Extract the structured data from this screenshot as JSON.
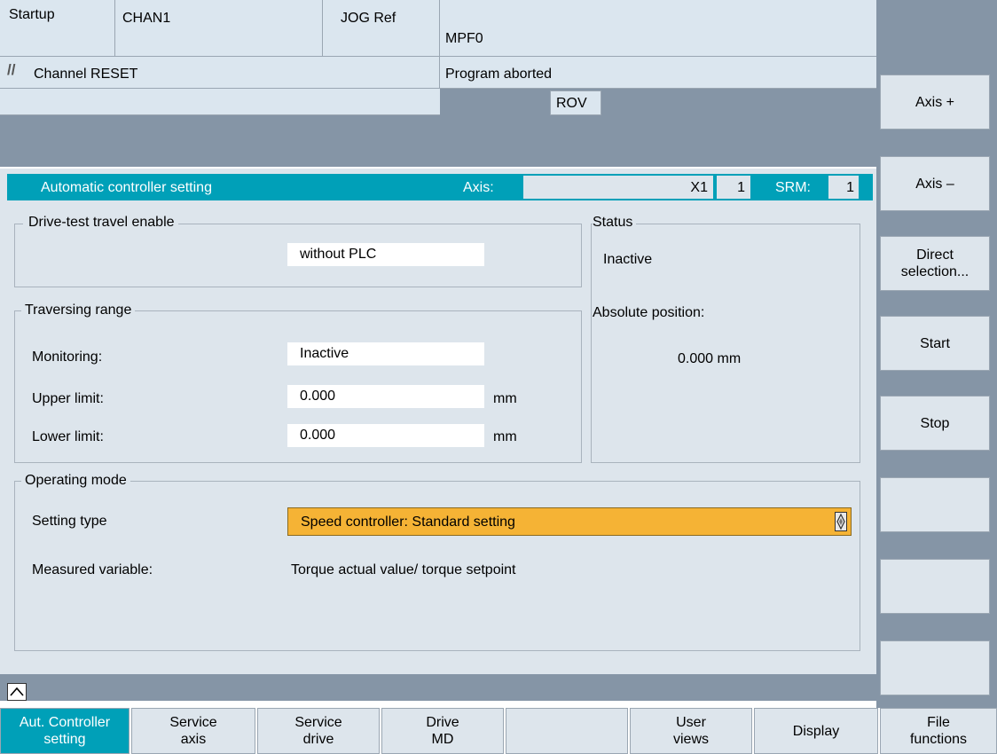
{
  "header": {
    "area": "Startup",
    "channel": "CHAN1",
    "mode": "JOG Ref",
    "program": "MPF0",
    "channel_status": "Channel RESET",
    "program_status": "Program aborted",
    "override": "ROV"
  },
  "title_bar": {
    "title": "Automatic controller setting",
    "axis_label": "Axis:",
    "axis_name": "X1",
    "axis_number": "1",
    "srm_label": "SRM:",
    "srm_value": "1"
  },
  "drive_test": {
    "title": "Drive-test travel enable",
    "value": "without PLC"
  },
  "status": {
    "title": "Status",
    "value": "Inactive",
    "abs_label": "Absolute position:",
    "abs_value": "0.000 mm"
  },
  "traversing": {
    "title": "Traversing range",
    "monitoring_label": "Monitoring:",
    "monitoring_value": "Inactive",
    "upper_label": "Upper limit:",
    "upper_value": "0.000",
    "upper_unit": "mm",
    "lower_label": "Lower limit:",
    "lower_value": "0.000",
    "lower_unit": "mm"
  },
  "operating_mode": {
    "title": "Operating mode",
    "setting_label": "Setting type",
    "setting_value": "Speed controller: Standard setting",
    "measured_label": "Measured variable:",
    "measured_value": "Torque actual value/ torque setpoint"
  },
  "right_softkeys": [
    {
      "line1": "Axis +",
      "line2": ""
    },
    {
      "line1": "Axis –",
      "line2": ""
    },
    {
      "line1": "Direct",
      "line2": "selection..."
    },
    {
      "line1": "Start",
      "line2": ""
    },
    {
      "line1": "Stop",
      "line2": ""
    },
    {
      "line1": "",
      "line2": ""
    },
    {
      "line1": "",
      "line2": ""
    },
    {
      "line1": "",
      "line2": ""
    }
  ],
  "bottom_softkeys": [
    {
      "line1": "Aut. Controller",
      "line2": "setting"
    },
    {
      "line1": "Service",
      "line2": "axis"
    },
    {
      "line1": "Service",
      "line2": "drive"
    },
    {
      "line1": "Drive",
      "line2": "MD"
    },
    {
      "line1": "",
      "line2": ""
    },
    {
      "line1": "User",
      "line2": "views"
    },
    {
      "line1": "Display",
      "line2": ""
    },
    {
      "line1": "File",
      "line2": "functions"
    }
  ],
  "colors": {
    "accent": "#00a0b8",
    "highlight": "#f5b335",
    "panel": "#dde5ec",
    "dark_band": "#8595a6"
  },
  "icons": {
    "reset": "double-slash-icon",
    "recall": "chevron-up-icon",
    "dropdown": "toggle-icon"
  }
}
